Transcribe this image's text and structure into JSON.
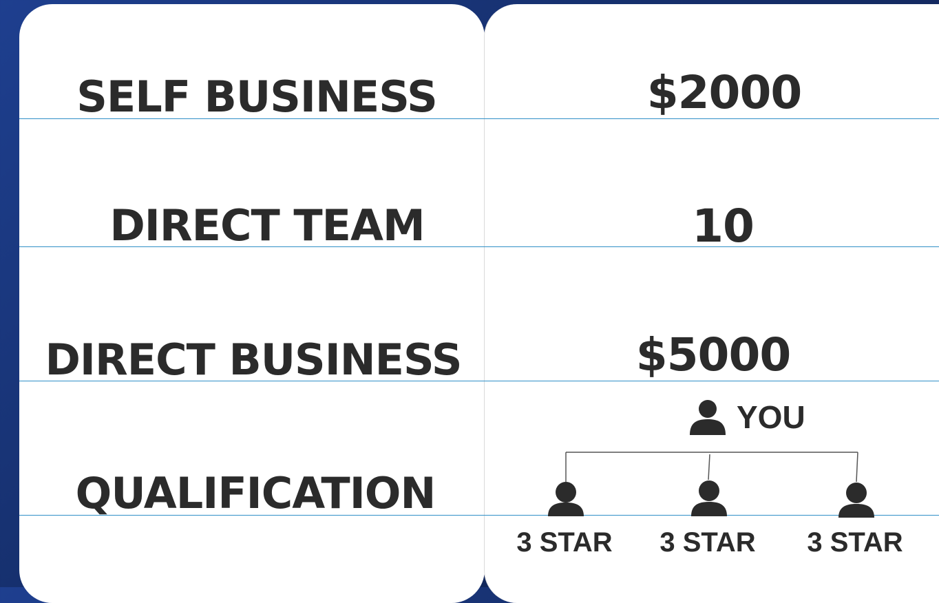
{
  "rows": [
    {
      "label": "SELF BUSINESS",
      "value": "$2000"
    },
    {
      "label": "DIRECT TEAM",
      "value": "10"
    },
    {
      "label": "DIRECT BUSINESS",
      "value": "$5000"
    },
    {
      "label": "QUALIFICATION"
    }
  ],
  "qualification": {
    "root_label": "YOU",
    "root_icon": "person-icon",
    "children": [
      {
        "label": "3 STAR",
        "icon": "person-icon"
      },
      {
        "label": "3 STAR",
        "icon": "person-icon"
      },
      {
        "label": "3 STAR",
        "icon": "person-icon"
      }
    ]
  },
  "colors": {
    "background": "#1e3f8f",
    "panel": "#ffffff",
    "divider": "#2f8fc7",
    "text": "#2b2b2b"
  }
}
